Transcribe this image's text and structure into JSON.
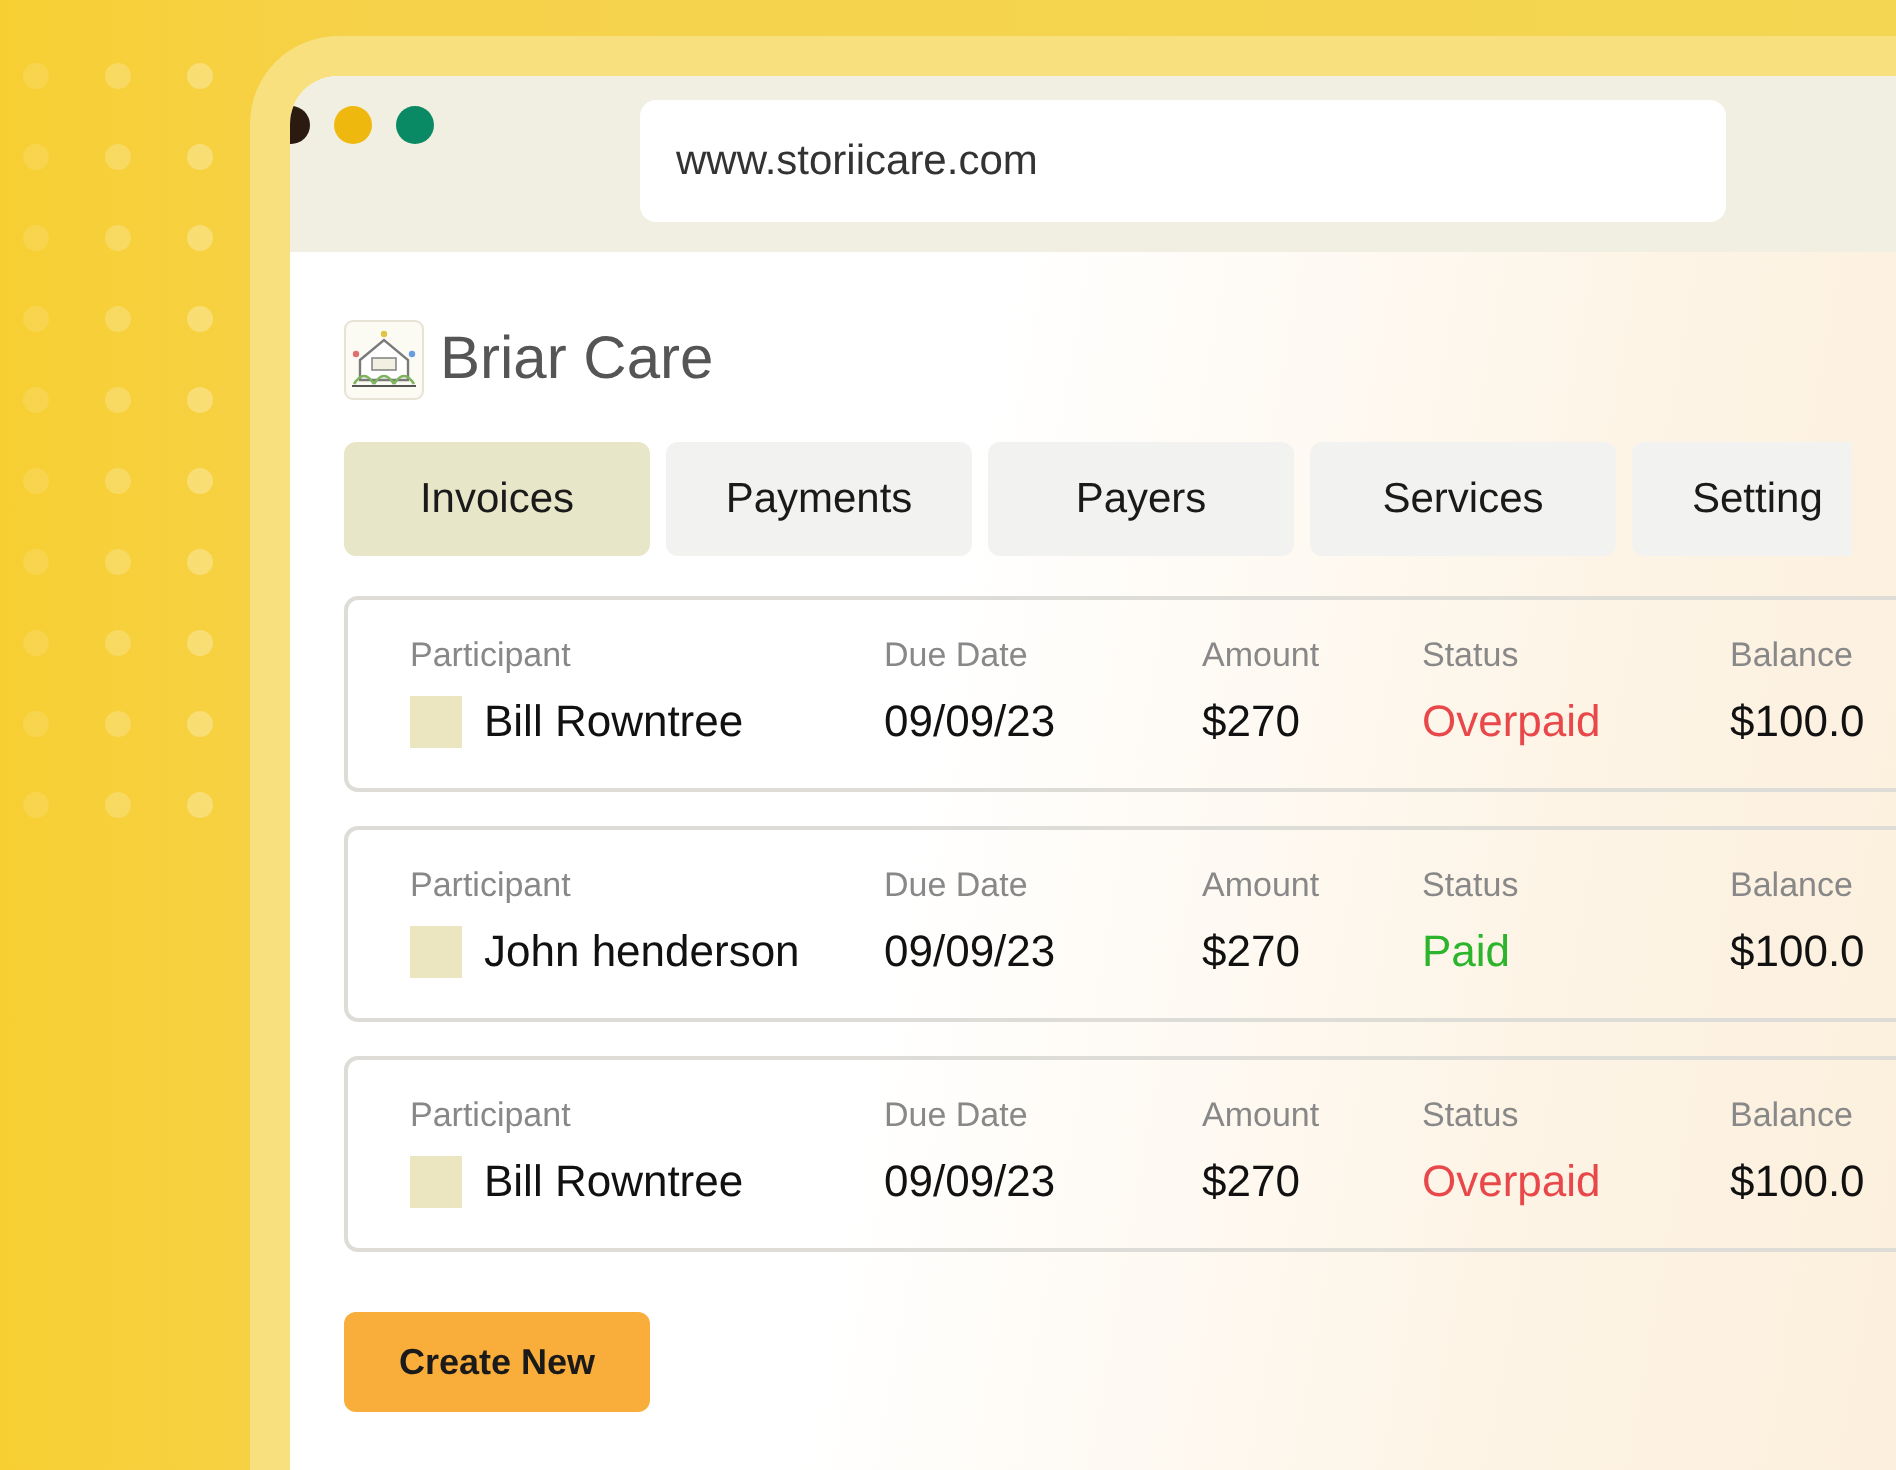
{
  "browser": {
    "url": "www.storiicare.com"
  },
  "app": {
    "title": "Briar Care"
  },
  "tabs": [
    {
      "label": "Invoices",
      "selected": true
    },
    {
      "label": "Payments",
      "selected": false
    },
    {
      "label": "Payers",
      "selected": false
    },
    {
      "label": "Services",
      "selected": false
    },
    {
      "label": "Setting",
      "selected": false
    }
  ],
  "invoices": [
    {
      "participant": {
        "label": "Participant",
        "value": "Bill Rowntree"
      },
      "due_date": {
        "label": "Due Date",
        "value": "09/09/23"
      },
      "amount": {
        "label": "Amount",
        "value": "$270"
      },
      "status": {
        "label": "Status",
        "value": "Overpaid",
        "color": "#e8484a"
      },
      "balance": {
        "label": "Balance",
        "value": "$100.0"
      }
    },
    {
      "participant": {
        "label": "Participant",
        "value": "John henderson"
      },
      "due_date": {
        "label": "Due Date",
        "value": "09/09/23"
      },
      "amount": {
        "label": "Amount",
        "value": "$270"
      },
      "status": {
        "label": "Status",
        "value": "Paid",
        "color": "#2cb52c"
      },
      "balance": {
        "label": "Balance",
        "value": "$100.0"
      }
    },
    {
      "participant": {
        "label": "Participant",
        "value": "Bill Rowntree"
      },
      "due_date": {
        "label": "Due Date",
        "value": "09/09/23"
      },
      "amount": {
        "label": "Amount",
        "value": "$270"
      },
      "status": {
        "label": "Status",
        "value": "Overpaid",
        "color": "#e8484a"
      },
      "balance": {
        "label": "Balance",
        "value": "$100.0"
      }
    }
  ],
  "create_button": {
    "label": "Create New"
  }
}
